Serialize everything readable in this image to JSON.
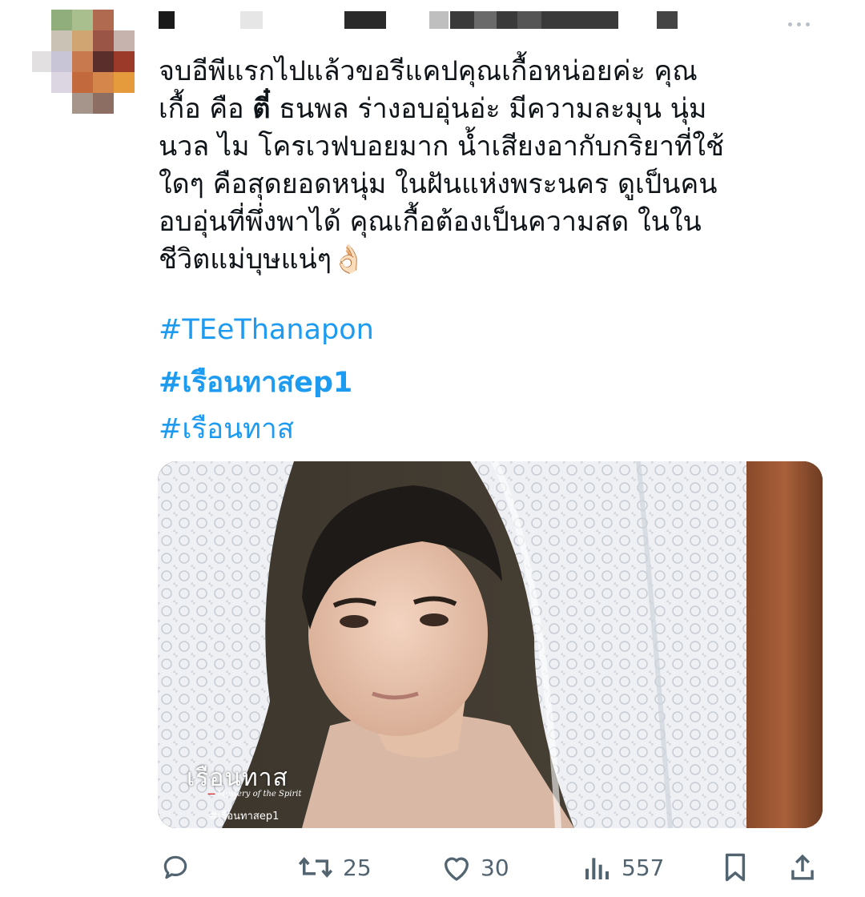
{
  "tweet": {
    "text_lines": [
      "จบอีพีแรกไปแล้วขอรีแคปคุณเกื้อหน่อยค่ะ คุณ",
      "เกื้อ คือ ตี๋ ธนพล ร่างอบอุ่นอ่ะ มีความละมุน นุ่ม",
      "นวล ไม โครเวฟบอยมาก น้ำเสียงอากับกริยาที่ใช้",
      "ใดๆ คือสุดยอดหนุ่ม ในฝันแห่งพระนคร ดูเป็นคน",
      "อบอุ่นที่พึ่งพาได้ คุณเกื้อต้องเป็นความสด ในใน",
      "ชีวิตแม่บุษแน่ๆ"
    ],
    "bold_word": "ตี๋",
    "emoji": "👌🏻",
    "hashtags": [
      "#TEeThanapon",
      "#เรือนทาสep1",
      "#เรือนทาส"
    ]
  },
  "media": {
    "title": "เรือนทาส",
    "subtitle": "Mystery of the Spirit",
    "tag": "#เรือนทาสep1"
  },
  "actions": {
    "reply_icon": "reply-icon",
    "retweet_count": "25",
    "like_count": "30",
    "views_count": "557"
  }
}
